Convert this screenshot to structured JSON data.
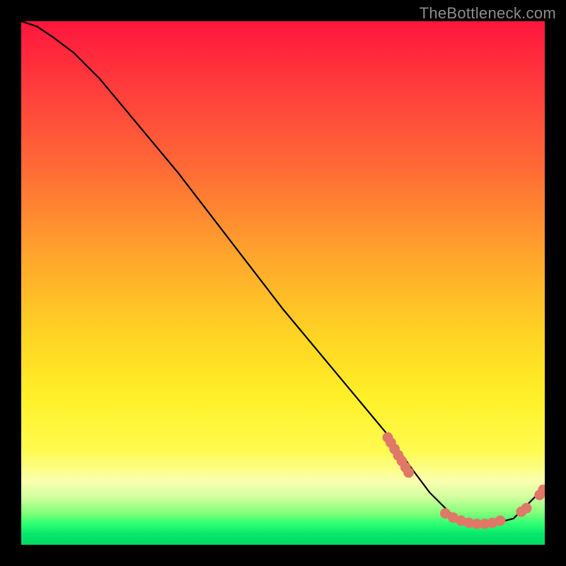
{
  "attribution": "TheBottleneck.com",
  "chart_data": {
    "type": "line",
    "title": "",
    "xlabel": "",
    "ylabel": "",
    "xlim": [
      0,
      100
    ],
    "ylim": [
      0,
      100
    ],
    "grid": false,
    "legend": false,
    "series": [
      {
        "name": "bottleneck-curve",
        "color": "#000000",
        "x": [
          0,
          3,
          6,
          10,
          15,
          20,
          30,
          40,
          50,
          60,
          70,
          75,
          78,
          82,
          86,
          90,
          94,
          97,
          100
        ],
        "y": [
          100,
          99,
          97,
          94,
          89,
          83,
          71,
          58,
          45,
          33,
          21,
          14,
          10,
          6,
          4,
          4,
          5,
          8,
          11
        ]
      }
    ],
    "scatter": {
      "name": "highlight-points",
      "color": "#e07868",
      "radius": 1.0,
      "points": [
        {
          "x": 70.0,
          "y": 20.5
        },
        {
          "x": 70.6,
          "y": 19.5
        },
        {
          "x": 71.3,
          "y": 18.3
        },
        {
          "x": 72.0,
          "y": 17.1
        },
        {
          "x": 72.7,
          "y": 16.0
        },
        {
          "x": 73.4,
          "y": 14.8
        },
        {
          "x": 74.0,
          "y": 13.8
        },
        {
          "x": 81.0,
          "y": 6.0
        },
        {
          "x": 82.5,
          "y": 5.2
        },
        {
          "x": 84.0,
          "y": 4.6
        },
        {
          "x": 85.5,
          "y": 4.2
        },
        {
          "x": 87.0,
          "y": 4.0
        },
        {
          "x": 88.5,
          "y": 4.0
        },
        {
          "x": 90.0,
          "y": 4.2
        },
        {
          "x": 91.5,
          "y": 4.6
        },
        {
          "x": 95.5,
          "y": 6.3
        },
        {
          "x": 96.5,
          "y": 7.0
        },
        {
          "x": 99.0,
          "y": 9.5
        },
        {
          "x": 99.7,
          "y": 10.5
        }
      ]
    }
  }
}
